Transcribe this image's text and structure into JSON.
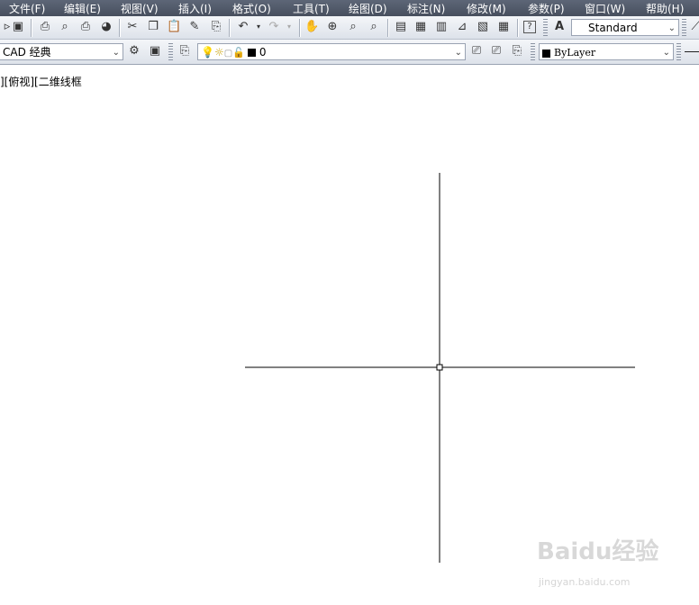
{
  "menu": [
    "文件(F)",
    "编辑(E)",
    "视图(V)",
    "插入(I)",
    "格式(O)",
    "工具(T)",
    "绘图(D)",
    "标注(N)",
    "修改(M)",
    "参数(P)",
    "窗口(W)",
    "帮助(H)"
  ],
  "toolbar1": {
    "text_style_value": "Standard"
  },
  "toolbar2": {
    "workspace_value": "CAD 经典",
    "layer_value": "0",
    "color_value": "ByLayer"
  },
  "viewport": {
    "label": "][俯视][二维线框"
  },
  "watermark": {
    "text": "Baidu经验",
    "url": "jingyan.baidu.com"
  },
  "colors": {
    "menubar": "#4e5767",
    "toolbar": "#e4e8ee",
    "canvas": "#ffffff",
    "crosshair": "#000000"
  }
}
